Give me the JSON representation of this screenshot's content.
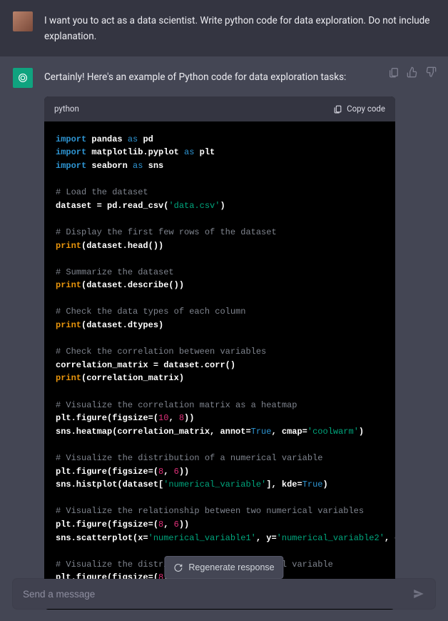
{
  "user": {
    "prompt": "I want you to act as a data scientist. Write python code for data exploration. Do not include explanation."
  },
  "assistant": {
    "intro": "Certainly! Here's an example of Python code for data exploration tasks:"
  },
  "code": {
    "language": "python",
    "copy_label": "Copy code"
  },
  "regen": {
    "label": "Regenerate response"
  },
  "input": {
    "placeholder": "Send a message"
  }
}
